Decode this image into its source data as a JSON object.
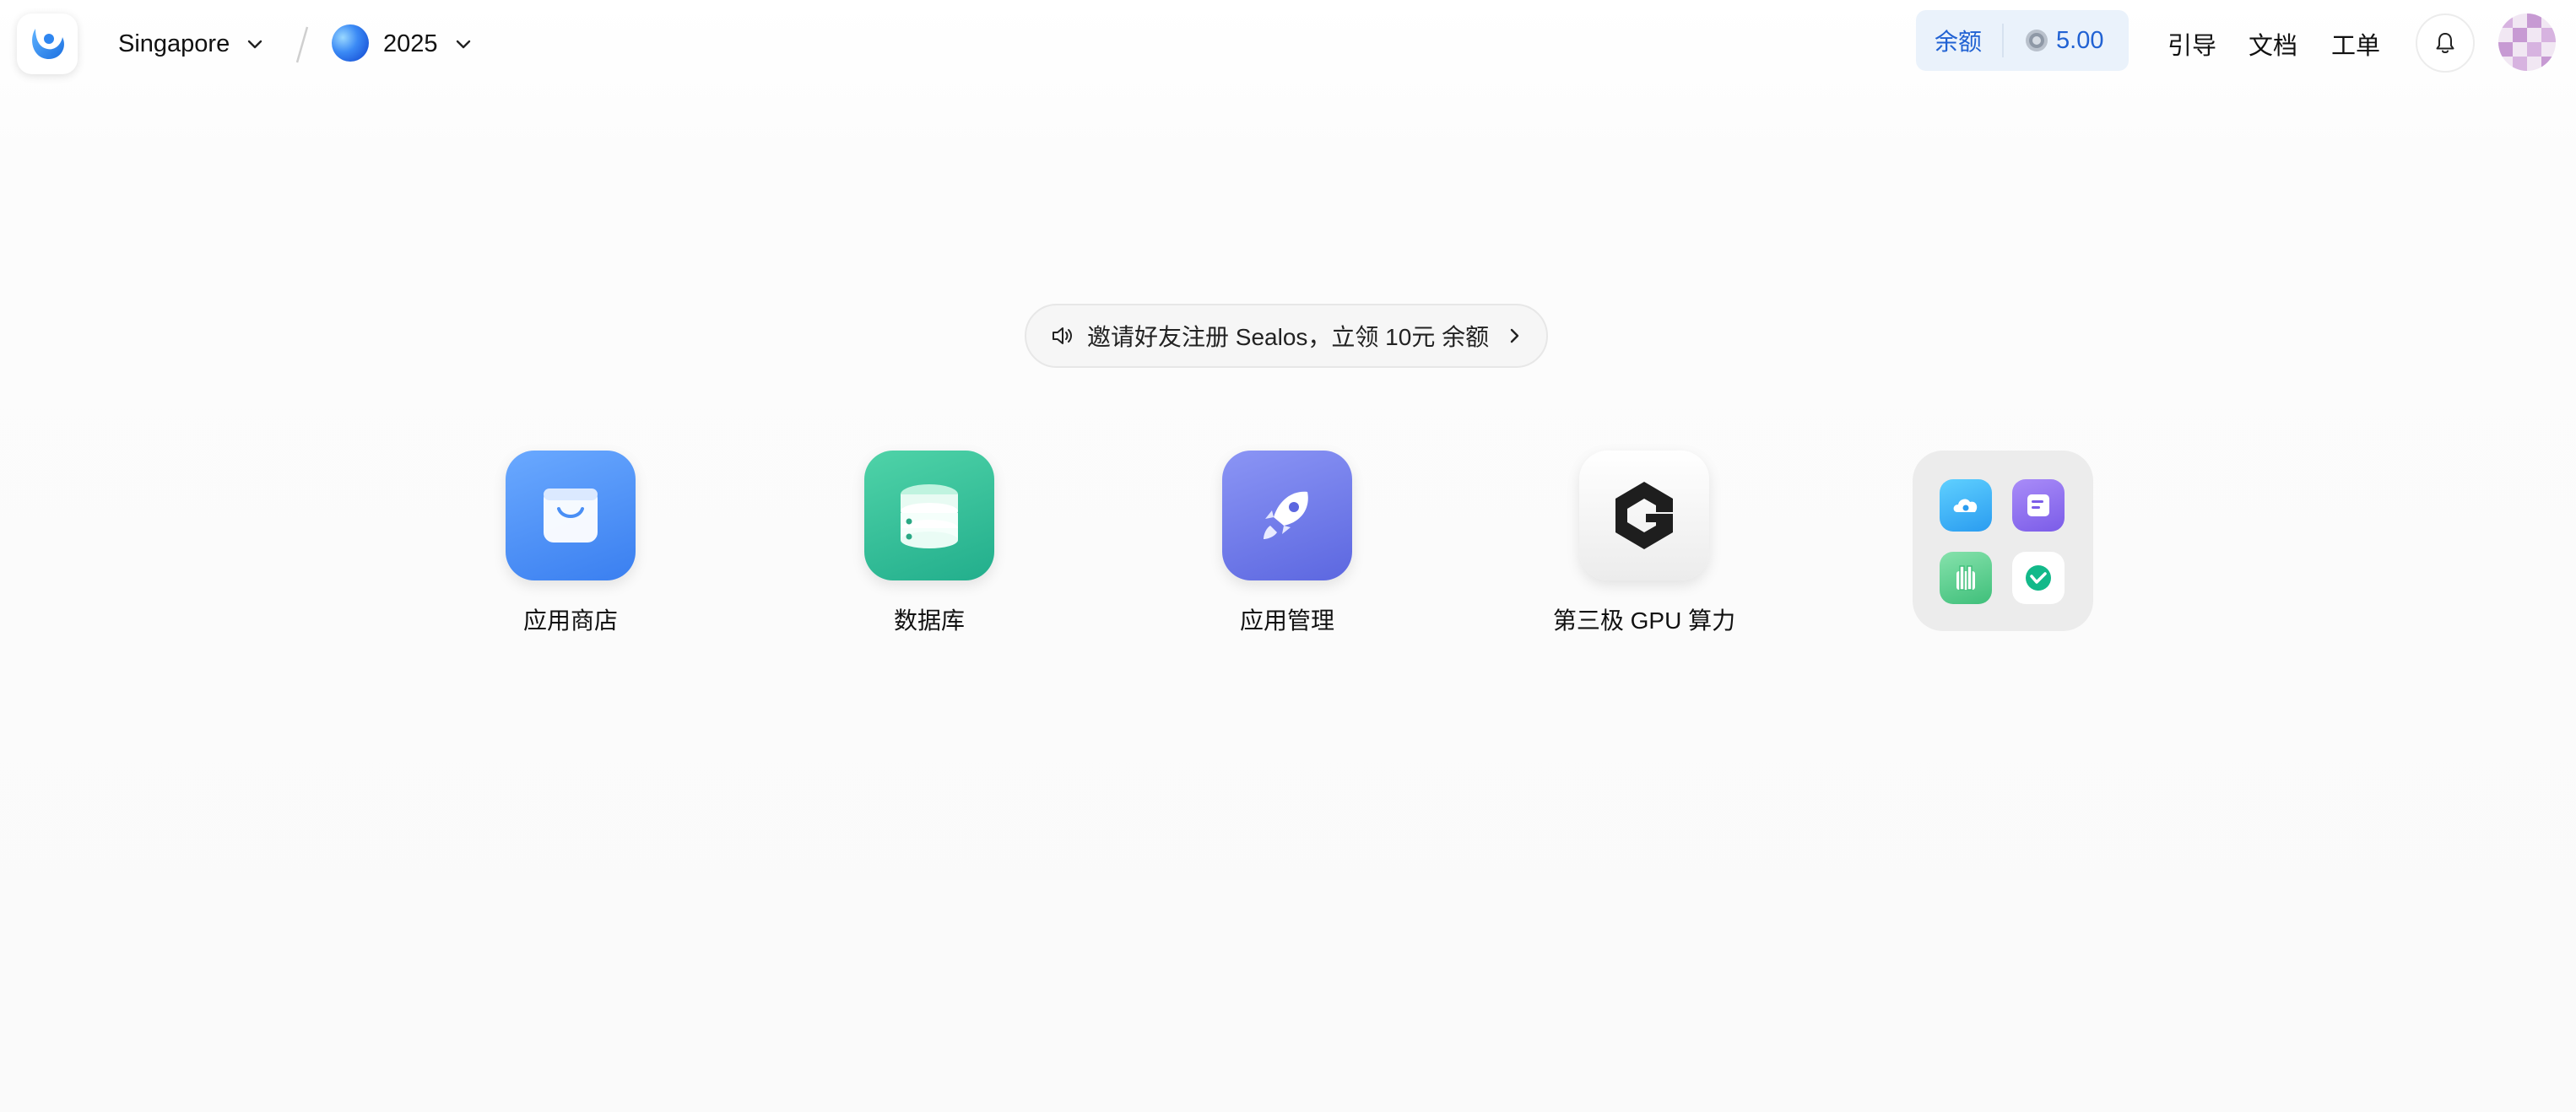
{
  "header": {
    "region": "Singapore",
    "workspace": "2025",
    "balance_label": "余额",
    "balance_value": "5.00",
    "nav": [
      "引导",
      "文档",
      "工单"
    ]
  },
  "announcement": {
    "text": "邀请好友注册 Sealos，立领 10元 余额"
  },
  "apps": [
    {
      "label": "应用商店",
      "icon": "shopping-bag-icon",
      "color": "#4c8ff8"
    },
    {
      "label": "数据库",
      "icon": "database-icon",
      "color": "#2fbf98"
    },
    {
      "label": "应用管理",
      "icon": "rocket-icon",
      "color": "#6f7be8"
    },
    {
      "label": "第三极 GPU 算力",
      "icon": "gpu-g-logo-icon",
      "color": "#f2f2f2"
    }
  ],
  "folder_icons": [
    "cloud-storage-icon",
    "notes-app-icon",
    "gift-box-icon",
    "green-check-logo-icon"
  ],
  "colors": {
    "accent": "#2162d3",
    "balance_bg": "#eaf2fb"
  }
}
